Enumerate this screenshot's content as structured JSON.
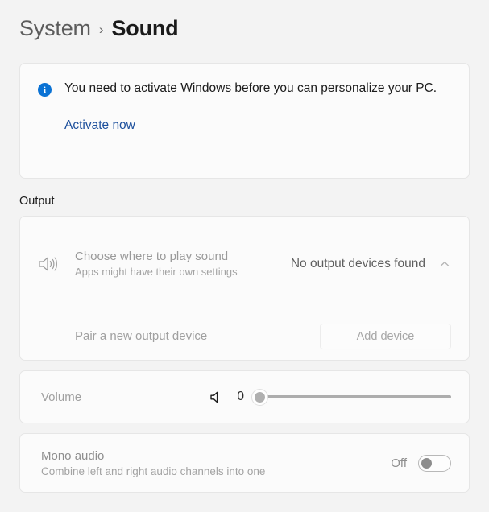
{
  "header": {
    "parent": "System",
    "separator": "›",
    "current": "Sound"
  },
  "banner": {
    "icon": "info-icon",
    "icon_glyph": "i",
    "message": "You need to activate Windows before you can personalize your PC.",
    "link_label": "Activate now",
    "link_color": "#1c4f9c",
    "icon_color": "#0a72d4"
  },
  "output": {
    "section_label": "Output",
    "device_row": {
      "icon": "speaker-volume-icon",
      "title": "Choose where to play sound",
      "subtitle": "Apps might have their own settings",
      "value": "No output devices found",
      "chevron": "chevron-up-icon"
    },
    "pair_row": {
      "label": "Pair a new output device",
      "button_label": "Add device"
    }
  },
  "volume": {
    "label": "Volume",
    "icon": "speaker-mute-icon",
    "value": "0",
    "level_percent": 0,
    "min": 0,
    "max": 100
  },
  "mono_audio": {
    "title": "Mono audio",
    "description": "Combine left and right audio channels into one",
    "state_label": "Off",
    "enabled": false
  }
}
